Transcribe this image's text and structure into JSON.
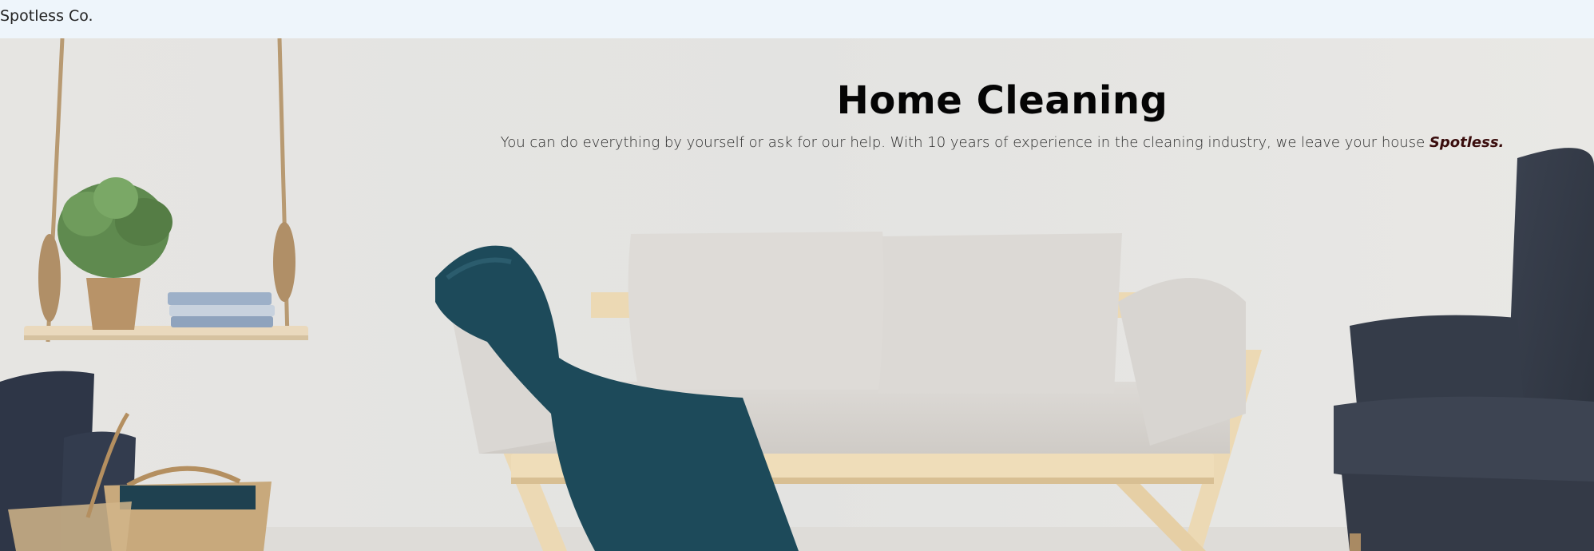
{
  "navbar": {
    "brand": "Spotless Co."
  },
  "hero": {
    "title": "Home Cleaning",
    "subtitle_text": "You can do everything by yourself or ask for our help. With 10 years of experience in the cleaning industry, we leave your house",
    "subtitle_emphasis": "Spotless."
  },
  "colors": {
    "navbar_bg": "#eef5fb",
    "emphasis": "#3a0d0d",
    "wall": "#e7e6e3"
  },
  "image": {
    "description_icons": [
      "hanging-shelf-icon",
      "plant-icon",
      "books-icon",
      "sofa-icon",
      "throw-blanket-icon",
      "armchair-icon",
      "basket-icon",
      "cushion-icon"
    ]
  }
}
